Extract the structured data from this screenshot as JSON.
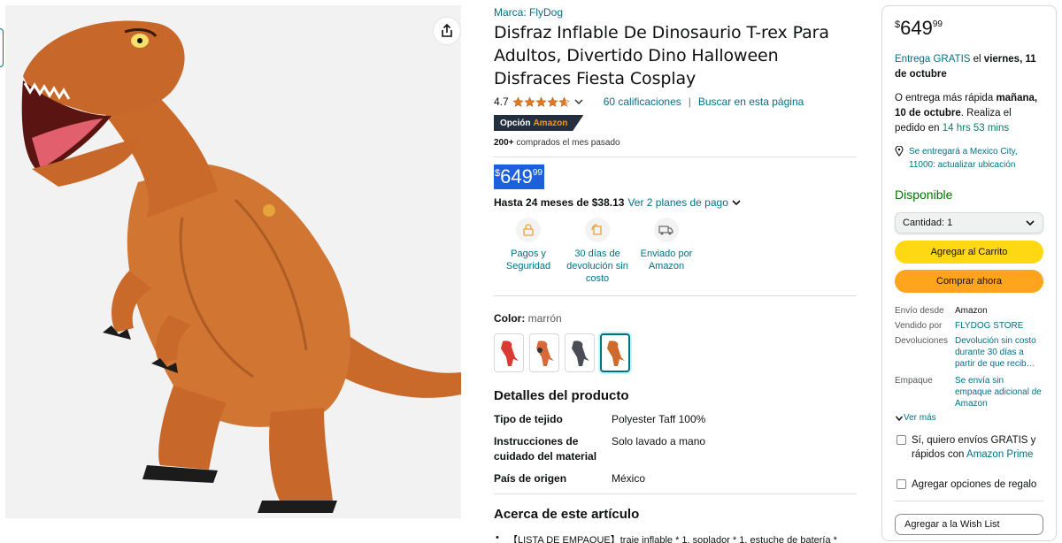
{
  "product": {
    "brand": "Marca: FlyDog",
    "title": "Disfraz Inflable De Dinosaurio T-rex Para Adultos, Divertido Dino Halloween Disfraces Fiesta Cosplay",
    "rating": "4.7",
    "rating_fraction": 0.94,
    "ratings_link": "60 calificaciones",
    "search_link": "Buscar en esta página",
    "badge_prefix": "Opción",
    "badge_brand": "Amazon",
    "bought_bold": "200+",
    "bought_rest": "comprados el mes pasado",
    "price": {
      "currency": "$",
      "whole": "649",
      "fraction": "99"
    },
    "installments_bold": "Hasta 24 meses de $38.13",
    "installments_link": "Ver 2 planes de pago",
    "features": [
      {
        "label": "Pagos y Seguridad",
        "icon": "secure-payment-icon"
      },
      {
        "label": "30 días de devolución sin costo",
        "icon": "return-icon"
      },
      {
        "label": "Enviado por Amazon",
        "icon": "delivery-truck-icon"
      }
    ],
    "color_label": "Color:",
    "color_value": "marrón",
    "swatches": [
      {
        "name": "rojo",
        "color": "#d93b33"
      },
      {
        "name": "rosa",
        "color": "#d8693a"
      },
      {
        "name": "negro",
        "color": "#4a4d55"
      },
      {
        "name": "marrón",
        "color": "#cf6a2e"
      }
    ],
    "details_heading": "Detalles del producto",
    "details": [
      {
        "key": "Tipo de tejido",
        "value": "Polyester Taff 100%"
      },
      {
        "key": "Instrucciones de cuidado del material",
        "value": "Solo lavado a mano"
      },
      {
        "key": "País de origen",
        "value": "México"
      }
    ],
    "about_heading": "Acerca de este artículo",
    "about_first_bullet": "【LISTA DE EMPAQUE】traje inflable * 1, soplador * 1, estuche de batería *"
  },
  "buybox": {
    "price": {
      "currency": "$",
      "whole": "649",
      "fraction": "99"
    },
    "delivery_link": "Entrega GRATIS",
    "delivery_mid": "el",
    "delivery_date": "viernes, 11 de octubre",
    "fast_prefix": "O entrega más rápida",
    "fast_date": "mañana, 10 de octubre",
    "fast_mid": ". Realiza el pedido en",
    "fast_time": "14 hrs 53 mins",
    "location": "Se entregará a Mexico City, 11000: actualizar ubicación",
    "availability": "Disponible",
    "quantity": "Cantidad: 1",
    "add_to_cart": "Agregar al Carrito",
    "buy_now": "Comprar ahora",
    "info": [
      {
        "key": "Envío desde",
        "value": "Amazon",
        "link": false
      },
      {
        "key": "Vendido por",
        "value": "FLYDOG STORE",
        "link": true
      },
      {
        "key": "Devoluciones",
        "value": "Devolución sin costo durante 30 días a partir de que recib…",
        "link": true
      },
      {
        "key": "Empaque",
        "value": "Se envía sin empaque adicional de Amazon",
        "link": true
      }
    ],
    "see_more": "Ver más",
    "prime_text": "Sí, quiero envíos GRATIS y rápidos con",
    "prime_link": "Amazon Prime",
    "gift_text": "Agregar opciones de regalo",
    "wishlist": "Agregar a la Wish List"
  },
  "colors": {
    "link": "#007185",
    "cart": "#ffd814",
    "buy": "#ffa41c",
    "price_highlight": "#1d5fdc",
    "star": "#de7921",
    "available": "#007600"
  }
}
